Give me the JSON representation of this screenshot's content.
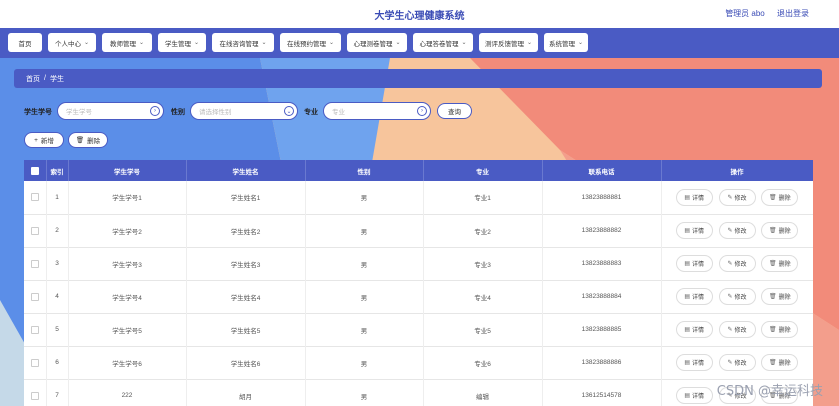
{
  "header": {
    "app_title": "大学生心理健康系统",
    "user_label": "管理员 abo",
    "logout_label": "退出登录"
  },
  "nav": {
    "items": [
      {
        "label": "首页",
        "has_dropdown": false
      },
      {
        "label": "个人中心",
        "has_dropdown": true
      },
      {
        "label": "教师管理",
        "has_dropdown": true
      },
      {
        "label": "学生管理",
        "has_dropdown": true
      },
      {
        "label": "在线咨询管理",
        "has_dropdown": true
      },
      {
        "label": "在线预约管理",
        "has_dropdown": true
      },
      {
        "label": "心理测卷管理",
        "has_dropdown": true
      },
      {
        "label": "心理答卷管理",
        "has_dropdown": true
      },
      {
        "label": "测评反馈管理",
        "has_dropdown": true
      },
      {
        "label": "系统管理",
        "has_dropdown": true
      }
    ]
  },
  "breadcrumb": {
    "home": "首页",
    "separator": "/",
    "current": "学生"
  },
  "search": {
    "student_id_label": "学生学号",
    "student_id_placeholder": "学生学号",
    "gender_label": "性别",
    "gender_placeholder": "请选择性别",
    "major_label": "专业",
    "major_placeholder": "专业",
    "search_button": "查询"
  },
  "actions": {
    "add_label": "新增",
    "delete_label": "删除"
  },
  "table": {
    "columns": [
      "索引",
      "学生学号",
      "学生姓名",
      "性别",
      "专业",
      "联系电话",
      "操作"
    ],
    "op_labels": {
      "detail": "详情",
      "edit": "修改",
      "delete": "删除"
    },
    "rows": [
      {
        "index": "1",
        "sid": "学生学号1",
        "name": "学生姓名1",
        "gender": "男",
        "major": "专业1",
        "phone": "13823888881"
      },
      {
        "index": "2",
        "sid": "学生学号2",
        "name": "学生姓名2",
        "gender": "男",
        "major": "专业2",
        "phone": "13823888882"
      },
      {
        "index": "3",
        "sid": "学生学号3",
        "name": "学生姓名3",
        "gender": "男",
        "major": "专业3",
        "phone": "13823888883"
      },
      {
        "index": "4",
        "sid": "学生学号4",
        "name": "学生姓名4",
        "gender": "男",
        "major": "专业4",
        "phone": "13823888884"
      },
      {
        "index": "5",
        "sid": "学生学号5",
        "name": "学生姓名5",
        "gender": "男",
        "major": "专业5",
        "phone": "13823888885"
      },
      {
        "index": "6",
        "sid": "学生学号6",
        "name": "学生姓名6",
        "gender": "男",
        "major": "专业6",
        "phone": "13823888886"
      },
      {
        "index": "7",
        "sid": "222",
        "name": "胡月",
        "gender": "男",
        "major": "编辑",
        "phone": "13612514578"
      }
    ]
  },
  "watermark": "CSDN @幸运科技",
  "colors": {
    "primary": "#4a5bc4",
    "bg_blue": "#5b8ee8",
    "bg_peach": "#f7c59c",
    "bg_salmon": "#f28b7a"
  }
}
